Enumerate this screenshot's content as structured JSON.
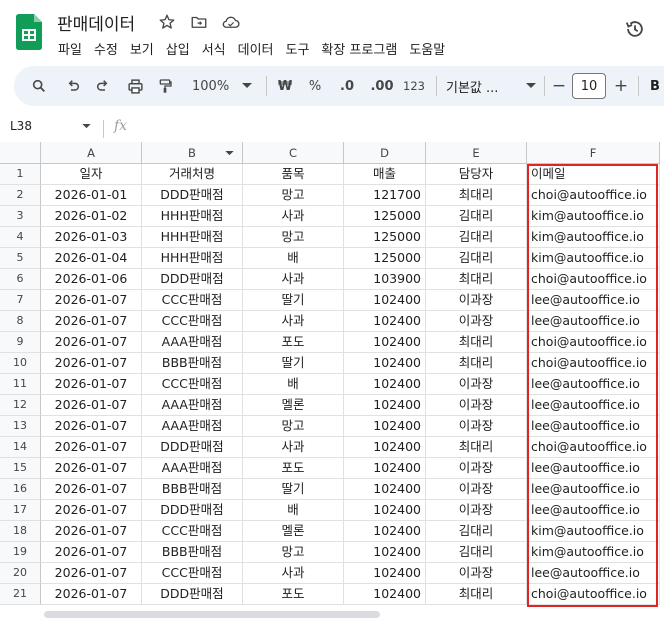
{
  "app": {
    "doc_title": "판매데이터",
    "menu": [
      "파일",
      "수정",
      "보기",
      "삽입",
      "서식",
      "데이터",
      "도구",
      "확장 프로그램",
      "도움말"
    ]
  },
  "toolbar": {
    "zoom": "100%",
    "currency": "₩",
    "percent": "%",
    "decrease_decimal": ".0",
    "increase_decimal": ".00",
    "number_format": "123",
    "font": "기본값 ...",
    "font_size": "10",
    "minus": "−",
    "plus": "+",
    "bold": "B"
  },
  "formula_bar": {
    "cell_ref": "L38",
    "fx": "fx"
  },
  "sheet": {
    "columns": [
      "A",
      "B",
      "C",
      "D",
      "E",
      "F"
    ],
    "header_row": [
      "일자",
      "거래처명",
      "품목",
      "매출",
      "담당자",
      "이메일"
    ],
    "rows": [
      [
        "2026-01-01",
        "DDD판매점",
        "망고",
        "121700",
        "최대리",
        "choi@autooffice.io"
      ],
      [
        "2026-01-02",
        "HHH판매점",
        "사과",
        "125000",
        "김대리",
        "kim@autooffice.io"
      ],
      [
        "2026-01-03",
        "HHH판매점",
        "망고",
        "125000",
        "김대리",
        "kim@autooffice.io"
      ],
      [
        "2026-01-04",
        "HHH판매점",
        "배",
        "125000",
        "김대리",
        "kim@autooffice.io"
      ],
      [
        "2026-01-06",
        "DDD판매점",
        "사과",
        "103900",
        "최대리",
        "choi@autooffice.io"
      ],
      [
        "2026-01-07",
        "CCC판매점",
        "딸기",
        "102400",
        "이과장",
        "lee@autooffice.io"
      ],
      [
        "2026-01-07",
        "CCC판매점",
        "사과",
        "102400",
        "이과장",
        "lee@autooffice.io"
      ],
      [
        "2026-01-07",
        "AAA판매점",
        "포도",
        "102400",
        "최대리",
        "choi@autooffice.io"
      ],
      [
        "2026-01-07",
        "BBB판매점",
        "딸기",
        "102400",
        "최대리",
        "choi@autooffice.io"
      ],
      [
        "2026-01-07",
        "CCC판매점",
        "배",
        "102400",
        "이과장",
        "lee@autooffice.io"
      ],
      [
        "2026-01-07",
        "AAA판매점",
        "멜론",
        "102400",
        "이과장",
        "lee@autooffice.io"
      ],
      [
        "2026-01-07",
        "AAA판매점",
        "망고",
        "102400",
        "이과장",
        "lee@autooffice.io"
      ],
      [
        "2026-01-07",
        "DDD판매점",
        "사과",
        "102400",
        "최대리",
        "choi@autooffice.io"
      ],
      [
        "2026-01-07",
        "AAA판매점",
        "포도",
        "102400",
        "이과장",
        "lee@autooffice.io"
      ],
      [
        "2026-01-07",
        "BBB판매점",
        "딸기",
        "102400",
        "이과장",
        "lee@autooffice.io"
      ],
      [
        "2026-01-07",
        "DDD판매점",
        "배",
        "102400",
        "이과장",
        "lee@autooffice.io"
      ],
      [
        "2026-01-07",
        "CCC판매점",
        "멜론",
        "102400",
        "김대리",
        "kim@autooffice.io"
      ],
      [
        "2026-01-07",
        "BBB판매점",
        "망고",
        "102400",
        "김대리",
        "kim@autooffice.io"
      ],
      [
        "2026-01-07",
        "CCC판매점",
        "사과",
        "102400",
        "이과장",
        "lee@autooffice.io"
      ],
      [
        "2026-01-07",
        "DDD판매점",
        "포도",
        "102400",
        "최대리",
        "choi@autooffice.io"
      ]
    ]
  },
  "colors": {
    "highlight": "#e02424",
    "sheets_green": "#0f9d58"
  }
}
